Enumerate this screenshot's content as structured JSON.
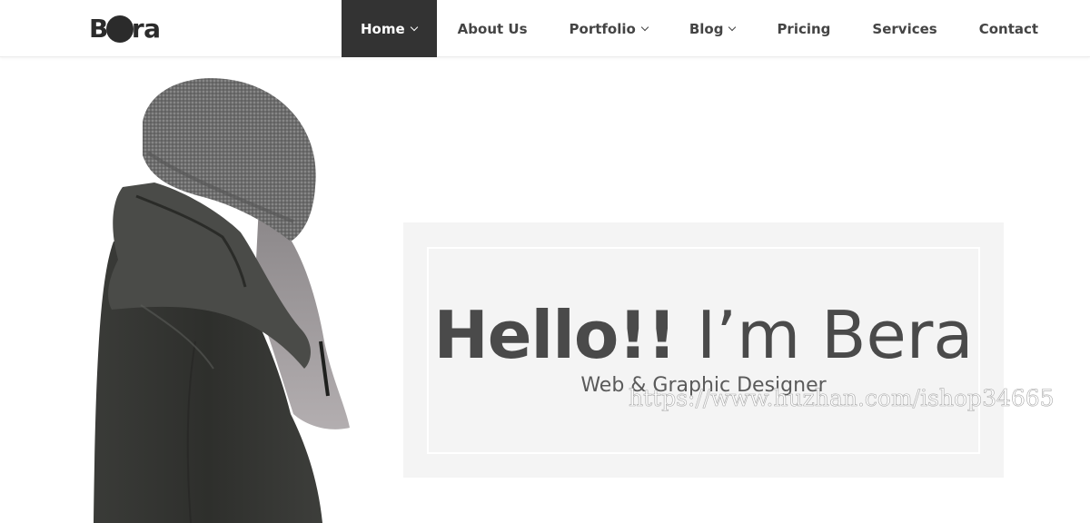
{
  "brand": {
    "logo_text_start": "B",
    "logo_text_end": "ra"
  },
  "nav": {
    "items": [
      {
        "label": "Home",
        "has_dropdown": true,
        "active": true
      },
      {
        "label": "About Us",
        "has_dropdown": false,
        "active": false
      },
      {
        "label": "Portfolio",
        "has_dropdown": true,
        "active": false
      },
      {
        "label": "Blog",
        "has_dropdown": true,
        "active": false
      },
      {
        "label": "Pricing",
        "has_dropdown": false,
        "active": false
      },
      {
        "label": "Services",
        "has_dropdown": false,
        "active": false
      },
      {
        "label": "Contact",
        "has_dropdown": false,
        "active": false
      }
    ],
    "active_color": "#333333"
  },
  "hero": {
    "greeting": "Hello!!",
    "name": " I’m Bera",
    "subtitle": "Web & Graphic Designer",
    "card_color": "#f4f4f4"
  },
  "watermark": "https://www.huzhan.com/ishop34665"
}
